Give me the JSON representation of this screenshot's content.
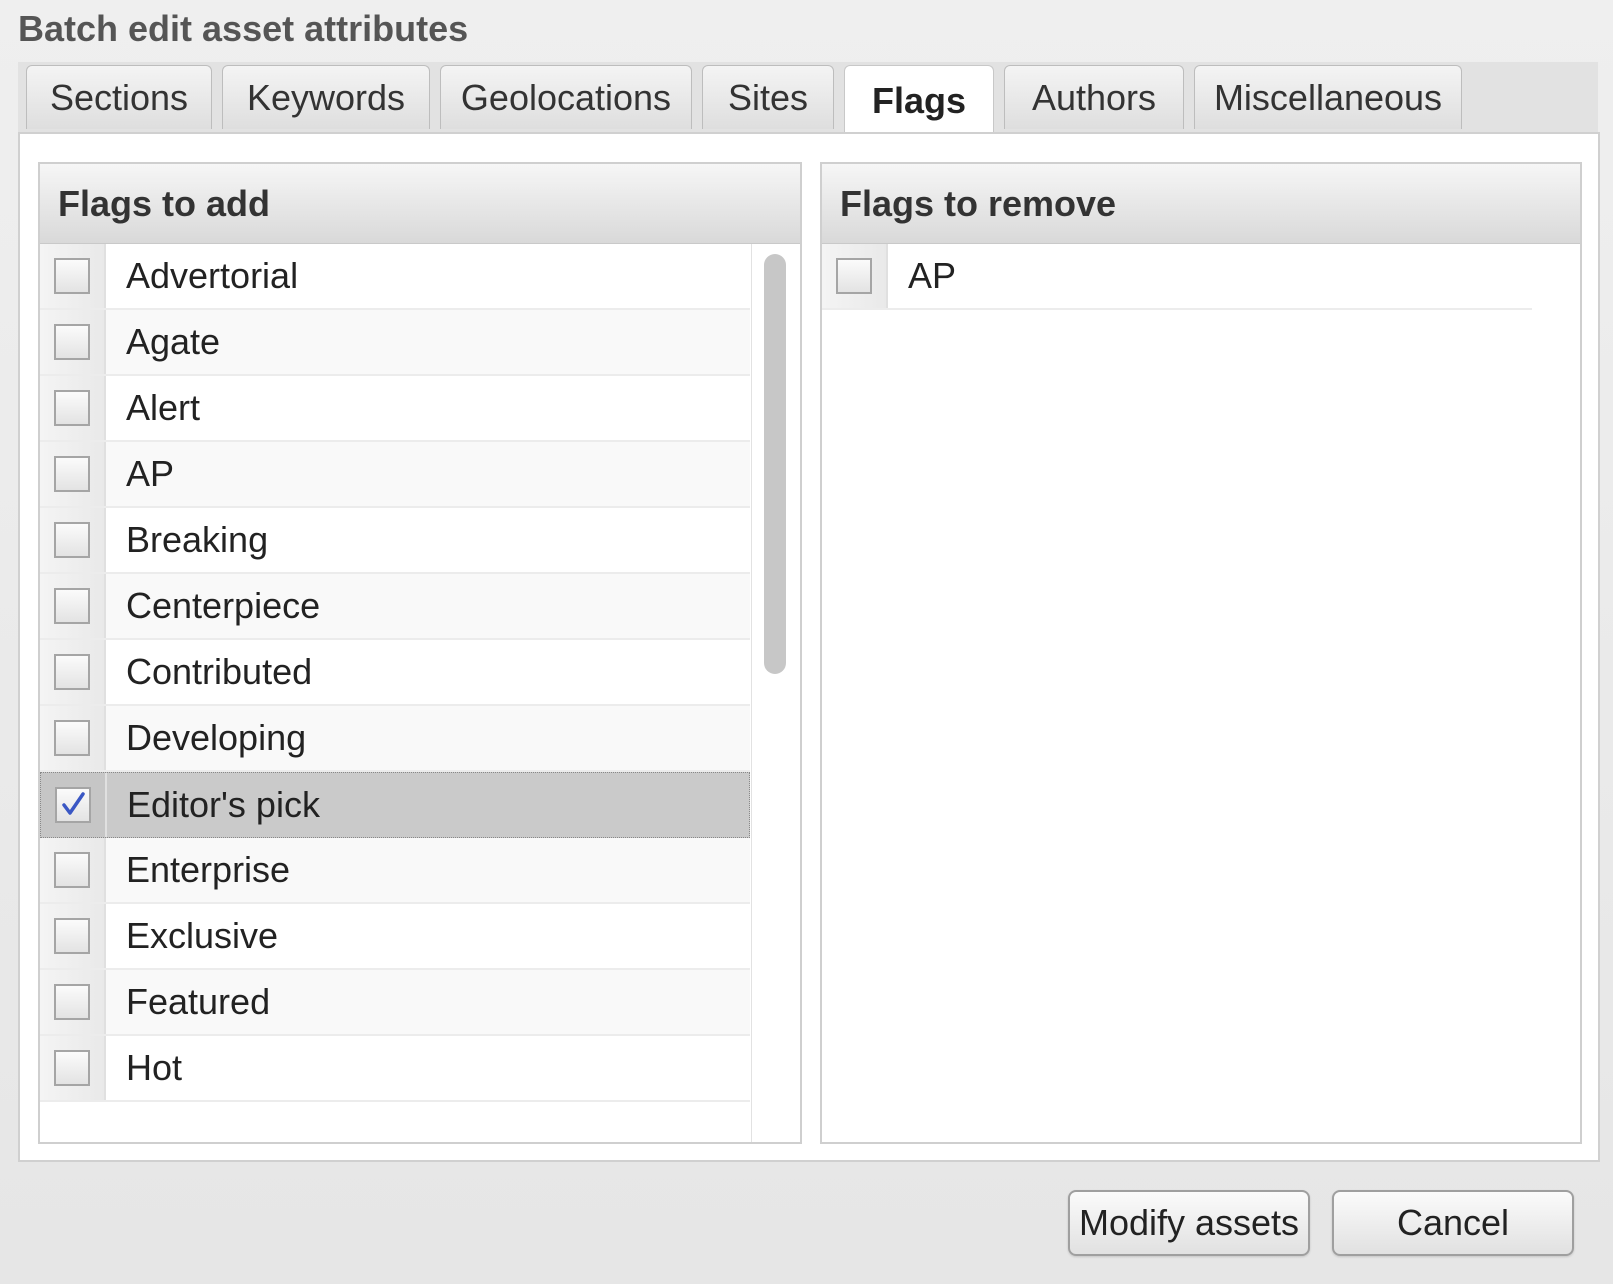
{
  "dialog": {
    "title": "Batch edit asset attributes"
  },
  "tabs": [
    {
      "label": "Sections"
    },
    {
      "label": "Keywords"
    },
    {
      "label": "Geolocations"
    },
    {
      "label": "Sites"
    },
    {
      "label": "Flags",
      "active": true
    },
    {
      "label": "Authors"
    },
    {
      "label": "Miscellaneous"
    }
  ],
  "flags_to_add": {
    "header": "Flags to add",
    "items": [
      {
        "label": "Advertorial",
        "checked": false
      },
      {
        "label": "Agate",
        "checked": false
      },
      {
        "label": "Alert",
        "checked": false
      },
      {
        "label": "AP",
        "checked": false
      },
      {
        "label": "Breaking",
        "checked": false
      },
      {
        "label": "Centerpiece",
        "checked": false
      },
      {
        "label": "Contributed",
        "checked": false
      },
      {
        "label": "Developing",
        "checked": false
      },
      {
        "label": "Editor's pick",
        "checked": true,
        "selected": true
      },
      {
        "label": "Enterprise",
        "checked": false
      },
      {
        "label": "Exclusive",
        "checked": false
      },
      {
        "label": "Featured",
        "checked": false
      },
      {
        "label": "Hot",
        "checked": false
      }
    ]
  },
  "flags_to_remove": {
    "header": "Flags to remove",
    "items": [
      {
        "label": "AP",
        "checked": false
      }
    ]
  },
  "buttons": {
    "modify_label": "Modify assets",
    "cancel_label": "Cancel"
  },
  "colors": {
    "selected_row": "#cacaca",
    "checkmark": "#3a57c4"
  }
}
